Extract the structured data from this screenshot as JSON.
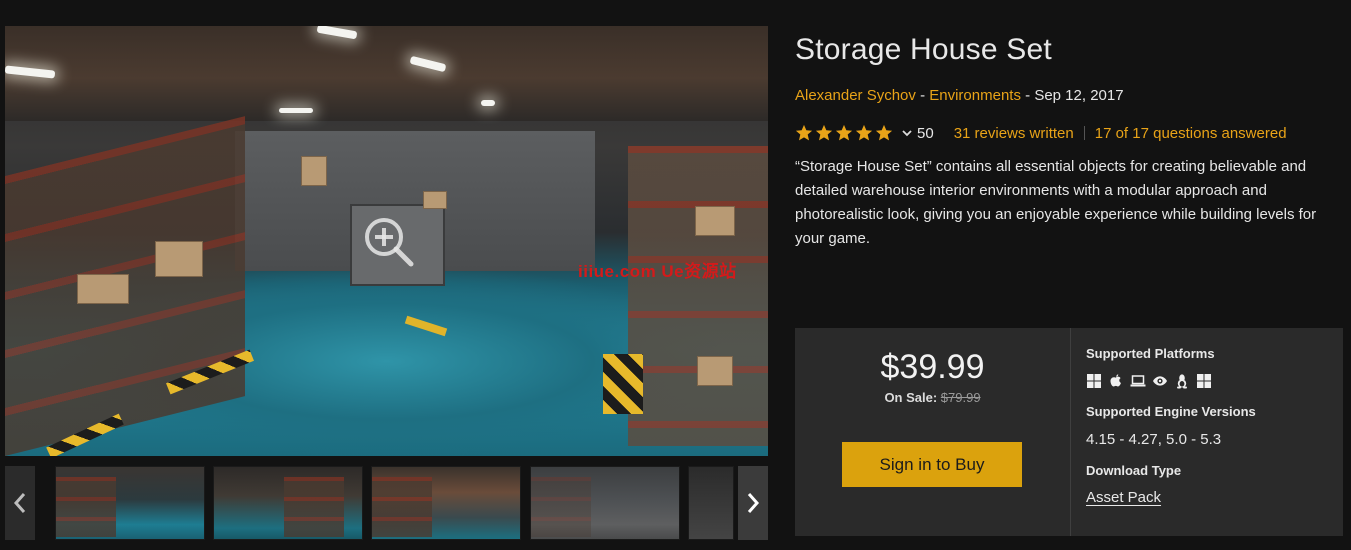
{
  "product": {
    "title": "Storage House Set",
    "author": "Alexander Sychov",
    "byline_sep1": " - ",
    "category": "Environments",
    "byline_sep2": " - ",
    "date": "Sep 12, 2017",
    "rating_count": "50",
    "reviews_link": "31 reviews written",
    "questions_link": "17 of 17 questions answered",
    "stars": 5,
    "description": "“Storage House Set” contains all essential objects for creating believable and detailed warehouse interior environments with a modular approach and photorealistic look, giving you an enjoyable experience while building levels for your game."
  },
  "purchase": {
    "price": "$39.99",
    "sale_label": "On Sale: ",
    "original_price": "$79.99",
    "buy_button": "Sign in to Buy"
  },
  "specs": {
    "platforms_heading": "Supported Platforms",
    "platform_icons": [
      "windows-icon",
      "apple-icon",
      "laptop-icon",
      "eye-icon",
      "linux-icon",
      "windows-icon"
    ],
    "engine_heading": "Supported Engine Versions",
    "engine_versions": "4.15 - 4.27, 5.0 - 5.3",
    "download_heading": "Download Type",
    "download_type": "Asset Pack"
  },
  "watermark": "iiiue.com  Ue资源站",
  "colors": {
    "accent": "#e8a318",
    "button": "#dba20d",
    "background": "#121212",
    "panel": "#2a2a2a"
  }
}
